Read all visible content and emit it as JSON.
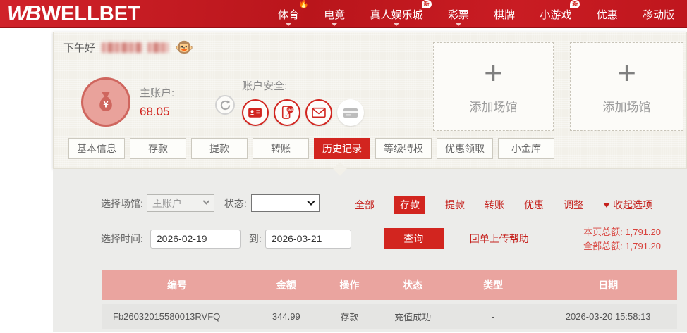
{
  "navbar": {
    "logo_mark": "WB",
    "logo_text": "WELLBET",
    "items": [
      {
        "label": "体育",
        "flame": true,
        "arrow": true
      },
      {
        "label": "电竞",
        "arrow": true
      },
      {
        "label": "真人娱乐城",
        "badge": "新",
        "arrow": true
      },
      {
        "label": "彩票",
        "arrow": true
      },
      {
        "label": "棋牌"
      },
      {
        "label": "小游戏",
        "badge": "新"
      },
      {
        "label": "优惠"
      },
      {
        "label": "移动版"
      }
    ]
  },
  "account": {
    "greeting": "下午好",
    "emoji": "🐵",
    "main_account_label": "主账户:",
    "balance": "68.05",
    "currency_symbol": "¥",
    "security_label": "账户安全:",
    "security_icons": [
      {
        "name": "id-card-icon",
        "style": "outline"
      },
      {
        "name": "sms-phone-icon",
        "style": "outline",
        "badge_text": "SMS"
      },
      {
        "name": "email-icon",
        "style": "outline"
      },
      {
        "name": "bank-card-icon",
        "style": "plain"
      }
    ],
    "add_venue": {
      "plus": "+",
      "label": "添加场馆"
    }
  },
  "tabs": [
    {
      "label": "基本信息"
    },
    {
      "label": "存款"
    },
    {
      "label": "提款"
    },
    {
      "label": "转账"
    },
    {
      "label": "历史记录",
      "active": true
    },
    {
      "label": "等级特权"
    },
    {
      "label": "优惠领取"
    },
    {
      "label": "小金库"
    }
  ],
  "filters": {
    "venue_label": "选择场馆:",
    "venue_value": "主账户",
    "status_label": "状态:",
    "status_value": "",
    "type_links": [
      {
        "label": "全部"
      },
      {
        "label": "存款",
        "active": true
      },
      {
        "label": "提款"
      },
      {
        "label": "转账"
      },
      {
        "label": "优惠"
      },
      {
        "label": "调整"
      }
    ],
    "collapse_label": "收起选项",
    "time_label": "选择时间:",
    "date_from": "2026-02-19",
    "to_label": "到:",
    "date_to": "2026-03-21",
    "query_label": "查询",
    "receipt_help_label": "回单上传帮助",
    "page_total_label": "本页总额:",
    "page_total_value": "1,791.20",
    "all_total_label": "全部总额:",
    "all_total_value": "1,791.20"
  },
  "table": {
    "headers": [
      "编号",
      "金额",
      "操作",
      "状态",
      "类型",
      "日期"
    ],
    "rows": [
      [
        "Fb26032015580013RVFQ",
        "344.99",
        "存款",
        "充值成功",
        "-",
        "2026-03-20 15:58:13"
      ]
    ]
  },
  "colors": {
    "navbar_red": "#c4161d",
    "accent_red": "#d2251f",
    "link_red": "#c5201c",
    "panel_beige": "#f2f0e9",
    "section_gray": "#ececea",
    "table_header_pink": "#eaa49f",
    "row_gray": "#e5e5e3"
  }
}
